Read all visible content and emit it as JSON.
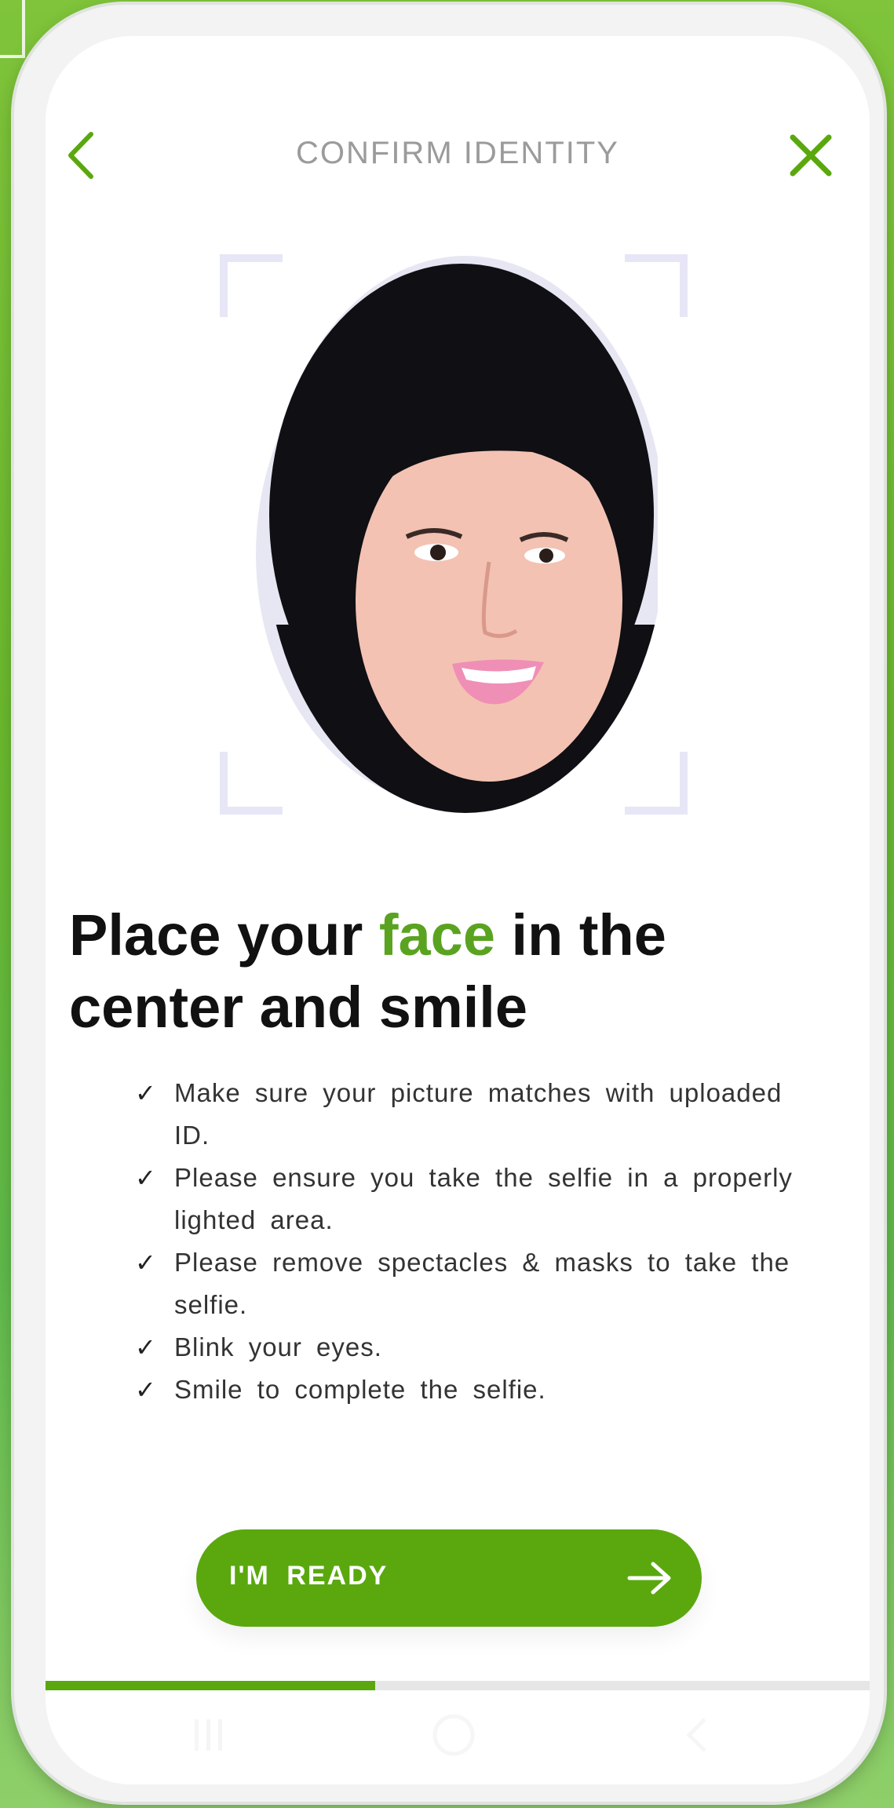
{
  "header": {
    "title": "CONFIRM IDENTITY"
  },
  "instruction": {
    "heading_before": "Place your ",
    "heading_accent": "face",
    "heading_after": " in the center and smile",
    "tips": [
      "Make sure your picture matches with uploaded ID.",
      "Please ensure you take the selfie in a properly lighted area.",
      "Please remove spectacles & masks to take the selfie.",
      "Blink your eyes.",
      "Smile to complete the selfie."
    ],
    "check_glyph": "✓"
  },
  "cta": {
    "label": "I'M READY"
  },
  "progress": {
    "fraction": 0.4
  },
  "icons": [
    "back-arrow-icon",
    "close-icon",
    "face-frame-icon",
    "check-icon",
    "arrow-right-icon"
  ],
  "colors": {
    "accent": "#5aa80e",
    "heading_accent": "#5aa320",
    "title_gray": "#9b9b9b"
  }
}
